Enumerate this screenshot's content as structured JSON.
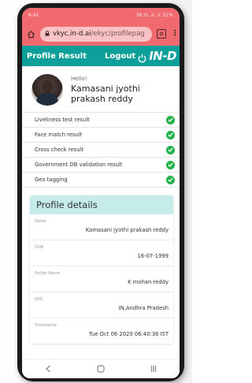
{
  "status_bar": {
    "time": "6:41",
    "indicators": "36 ⊡ .ıl .ıl 31%"
  },
  "browser": {
    "url_host": "vkyc.in-d.ai",
    "url_path": "/ekyc/profilepag",
    "tab_count": "⊡"
  },
  "app_bar": {
    "title": "Profile Result",
    "logout_label": "Logout",
    "brand": "IN-D"
  },
  "profile": {
    "greeting": "Hello!",
    "name": "Kamasani jyothi prakash reddy"
  },
  "checks": [
    {
      "label": "Liveliness test result",
      "status": "passed"
    },
    {
      "label": "Face match result",
      "status": "passed"
    },
    {
      "label": "Cross check result",
      "status": "passed"
    },
    {
      "label": "Government DB validation result",
      "status": "passed"
    },
    {
      "label": "Geo tagging",
      "status": "passed"
    }
  ],
  "details": {
    "header": "Profile details",
    "fields": [
      {
        "label": "Name",
        "value": "Kamasani jyothi prakash reddy"
      },
      {
        "label": "DOB",
        "value": "16-07-1999"
      },
      {
        "label": "Father Name",
        "value": "K mohan reddy"
      },
      {
        "label": "GPS",
        "value": "IN,Andhra Pradesh"
      },
      {
        "label": "Timestamp",
        "value": "Tue Oct 06 2020 06:40:36 IST"
      }
    ]
  },
  "colors": {
    "status": "#f06a6f",
    "appbar": "#0e9f9b",
    "header_bg": "#c6ecea",
    "success": "#24b34b"
  },
  "icons": {
    "nav": [
      "back-icon",
      "home-icon",
      "recents-icon"
    ]
  }
}
